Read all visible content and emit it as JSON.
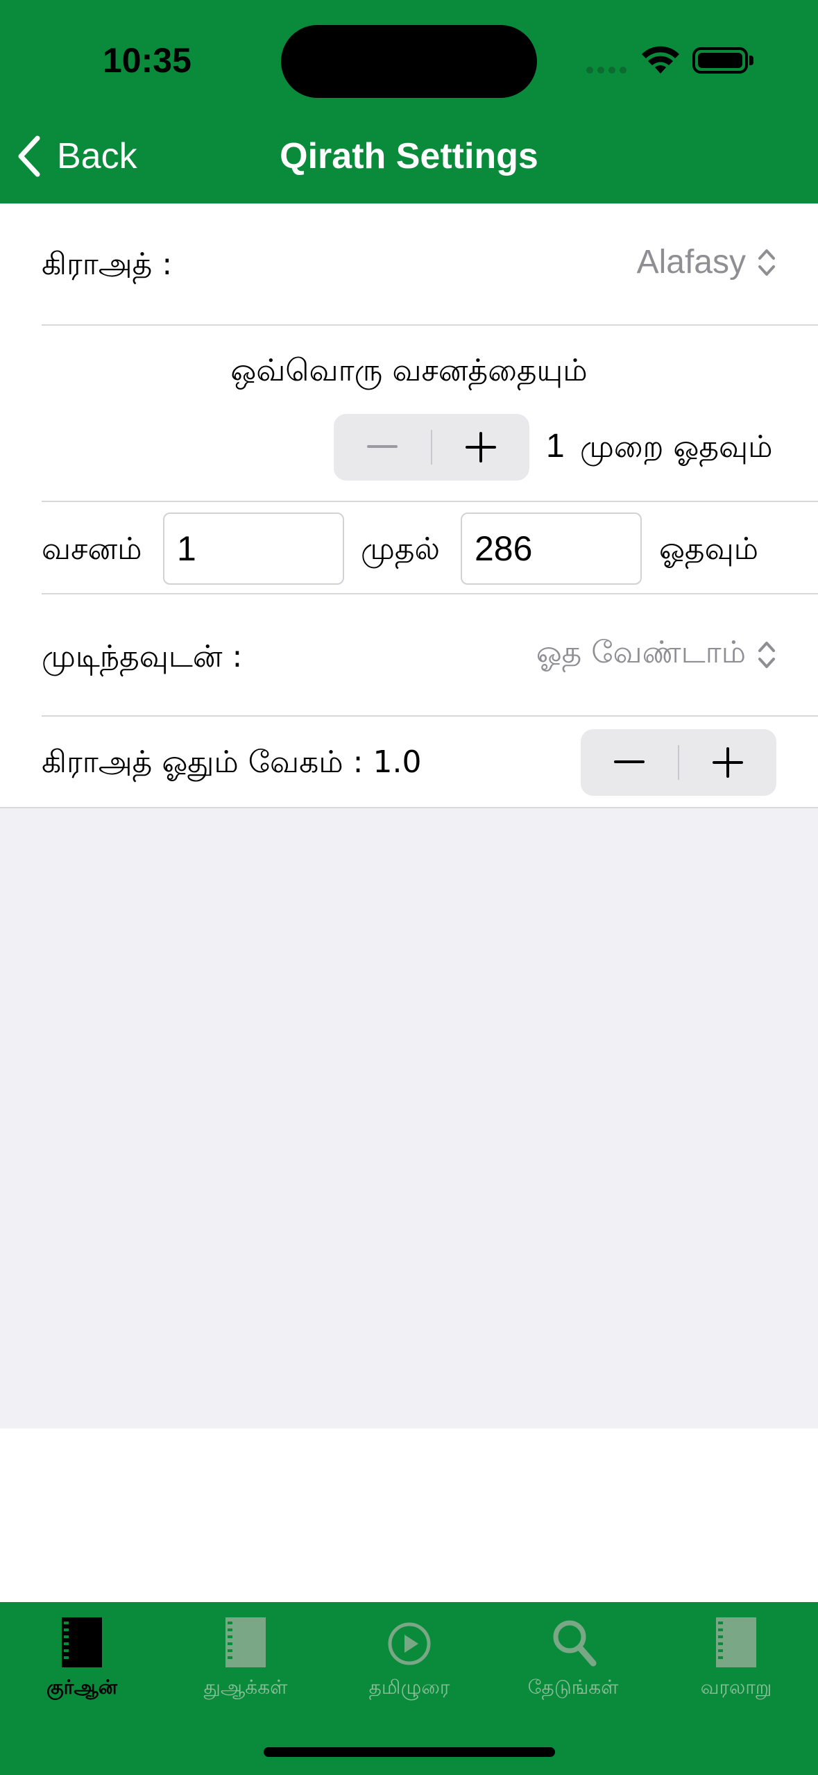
{
  "status_bar": {
    "time": "10:35"
  },
  "nav": {
    "back_label": "Back",
    "title": "Qirath Settings"
  },
  "settings": {
    "qirath": {
      "label": "கிராஅத் :",
      "value": "Alafasy"
    },
    "repeat": {
      "heading": "ஒவ்வொரு வசனத்தையும்",
      "count": "1",
      "suffix": "முறை ஓதவும்"
    },
    "range": {
      "verse_label": "வசனம்",
      "from_value": "1",
      "from_label": "முதல்",
      "to_value": "286",
      "to_label": "ஓதவும்"
    },
    "after_finish": {
      "label": "முடிந்தவுடன் :",
      "value": "ஓத வேண்டாம்"
    },
    "speed": {
      "label": "கிராஅத் ஓதும் வேகம் : 1.0"
    }
  },
  "tabs": [
    {
      "label": "குர்ஆன்",
      "icon": "book-icon",
      "active": true
    },
    {
      "label": "துஆக்கள்",
      "icon": "book-icon",
      "active": false
    },
    {
      "label": "தமிழுரை",
      "icon": "play-icon",
      "active": false
    },
    {
      "label": "தேடுங்கள்",
      "icon": "search-icon",
      "active": false
    },
    {
      "label": "வரலாறு",
      "icon": "book-icon",
      "active": false
    }
  ],
  "colors": {
    "brand_green": "#0a8b3c",
    "inactive_tab": "#8bbf9a",
    "secondary_text": "#8e8e93",
    "grouped_background": "#f0f0f5"
  }
}
